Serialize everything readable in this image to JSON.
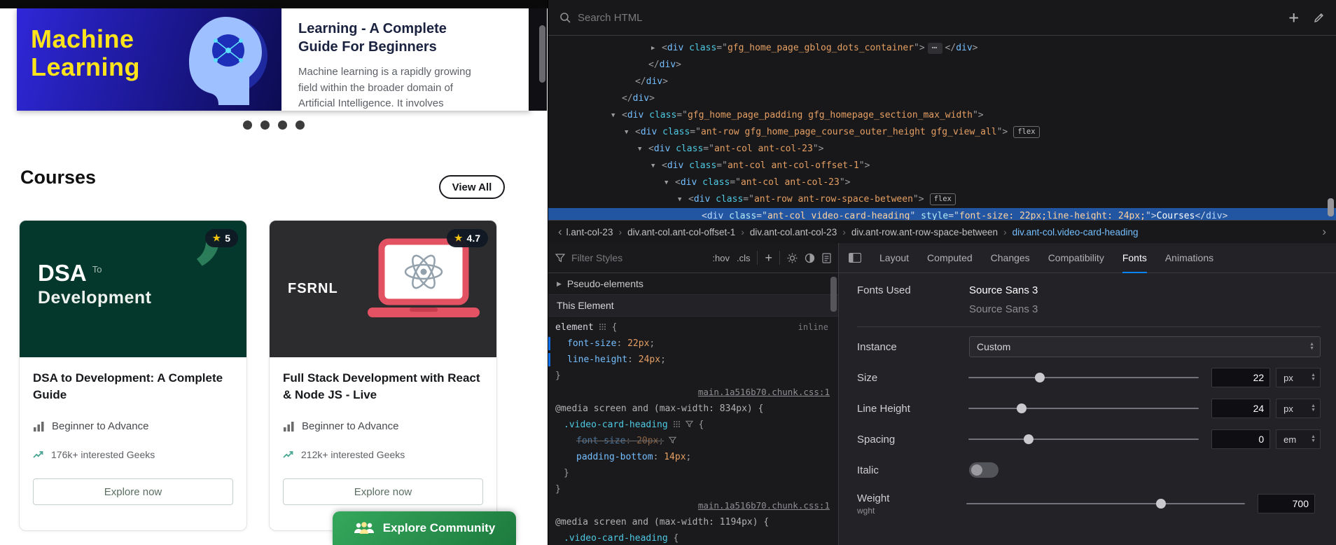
{
  "colors": {
    "accent": "#0a84ff",
    "selection_bg": "#2256a3",
    "devtools_bg": "#18181a",
    "border": "#3a3a3e",
    "tag": "#75bfff",
    "attribute": "#4ec9e1",
    "css_value": "#e59f63",
    "banner_yellow": "#ffe41c",
    "banner_blue": "#1c1894",
    "card1_green": "#05382c",
    "card2_gray": "#2c2c2f",
    "community_green": "#2f9e54",
    "star_yellow": "#f2c410"
  },
  "icons": {
    "star": "★",
    "ellipsis": "⋯",
    "collapse": "▼",
    "expand": "▶",
    "chevron_left": "‹",
    "chevron_right": "›",
    "plus": "+",
    "up": "▲",
    "down": "▼"
  },
  "page": {
    "carousel": {
      "banner_line1": "Machine",
      "banner_line2": "Learning",
      "title": "Learning - A Complete Guide For Beginners",
      "description": "Machine learning is a rapidly growing field within the broader domain of Artificial Intelligence. It involves developing algorithms that",
      "dot_count": 4
    },
    "courses": {
      "heading": "Courses",
      "view_all": "View All",
      "cards": [
        {
          "rating": "5",
          "img_line1": "DSA",
          "img_line1b": "To",
          "img_line2": "Development",
          "quote_glyph": "’",
          "title": "DSA to Development: A Complete Guide",
          "level": "Beginner to Advance",
          "interested": "176k+ interested Geeks",
          "cta": "Explore now"
        },
        {
          "rating": "4.7",
          "img_title": "FSRNL",
          "title": "Full Stack Development with React & Node JS - Live",
          "level": "Beginner to Advance",
          "interested": "212k+ interested Geeks",
          "cta": "Explore now"
        }
      ]
    },
    "community_button": "Explore Community"
  },
  "devtools": {
    "search_placeholder": "Search HTML",
    "markup_lines": [
      {
        "depth": 8,
        "tri": "expand",
        "tag": "div",
        "attrs": [
          [
            "class",
            "gfg_home_page_gblog_dots_container"
          ]
        ],
        "ellipsis": true
      },
      {
        "depth": 7,
        "close": "div"
      },
      {
        "depth": 6,
        "close": "div"
      },
      {
        "depth": 5,
        "close": "div"
      },
      {
        "depth": 5,
        "tri": "collapse",
        "tag": "div",
        "attrs": [
          [
            "class",
            "gfg_home_page_padding gfg_homepage_section_max_width"
          ]
        ]
      },
      {
        "depth": 6,
        "tri": "collapse",
        "tag": "div",
        "attrs": [
          [
            "class",
            "ant-row gfg_home_page_course_outer_height gfg_view_all"
          ]
        ],
        "badge": "flex"
      },
      {
        "depth": 7,
        "tri": "collapse",
        "tag": "div",
        "attrs": [
          [
            "class",
            "ant-col ant-col-23"
          ]
        ]
      },
      {
        "depth": 8,
        "tri": "collapse",
        "tag": "div",
        "attrs": [
          [
            "class",
            "ant-col ant-col-offset-1"
          ]
        ]
      },
      {
        "depth": 9,
        "tri": "collapse",
        "tag": "div",
        "attrs": [
          [
            "class",
            "ant-col ant-col-23"
          ]
        ]
      },
      {
        "depth": 10,
        "tri": "collapse",
        "tag": "div",
        "attrs": [
          [
            "class",
            "ant-row ant-row-space-between"
          ]
        ],
        "badge": "flex"
      },
      {
        "depth": 11,
        "selected": true,
        "tag": "div",
        "attrs": [
          [
            "class",
            "ant-col video-card-heading"
          ],
          [
            "style",
            "font-size: 22px;line-height: 24px;"
          ]
        ],
        "text": "Courses"
      }
    ],
    "breadcrumbs": {
      "items": [
        "l.ant-col-23",
        "div.ant-col.ant-col-offset-1",
        "div.ant-col.ant-col-23",
        "div.ant-row.ant-row-space-between",
        "div.ant-col.video-card-heading"
      ],
      "active_index": 4
    },
    "rules_panel": {
      "filter_placeholder": "Filter Styles",
      "hov": ":hov",
      "cls": ".cls",
      "plus": "+",
      "pseudo_header": "Pseudo-elements",
      "this_element_header": "This Element",
      "blocks": [
        {
          "kind": "rule",
          "selector": "element",
          "selector_type": "element",
          "location": "inline",
          "props": [
            {
              "name": "font-size",
              "value": "22px",
              "changed": true
            },
            {
              "name": "line-height",
              "value": "24px",
              "changed": true
            }
          ]
        },
        {
          "kind": "link",
          "text": "main.1a516b70.chunk.css:1"
        },
        {
          "kind": "media",
          "query": "@media screen and (max-width: 834px) {",
          "rules": [
            {
              "selector": ".video-card-heading",
              "props": [
                {
                  "name": "font-size",
                  "value": "20px",
                  "overridden": true
                },
                {
                  "name": "padding-bottom",
                  "value": "14px"
                }
              ]
            }
          ]
        },
        {
          "kind": "link",
          "text": "main.1a516b70.chunk.css:1"
        },
        {
          "kind": "media_partial",
          "query": "@media screen and (max-width: 1194px) {",
          "selector": ".video-card-heading"
        }
      ]
    },
    "fonts_panel": {
      "tabs": [
        "Layout",
        "Computed",
        "Changes",
        "Compatibility",
        "Fonts",
        "Animations"
      ],
      "active_tab": "Fonts",
      "fonts_used_label": "Fonts Used",
      "font_primary": "Source Sans 3",
      "font_secondary": "Source Sans 3",
      "controls": {
        "instance": {
          "label": "Instance",
          "value": "Custom"
        },
        "size": {
          "label": "Size",
          "value": "22",
          "unit": "px",
          "frac": 0.31
        },
        "line_height": {
          "label": "Line Height",
          "value": "24",
          "unit": "px",
          "frac": 0.23
        },
        "spacing": {
          "label": "Spacing",
          "value": "0",
          "unit": "em",
          "frac": 0.26
        },
        "italic": {
          "label": "Italic",
          "on": false
        },
        "weight": {
          "label": "Weight",
          "sub_label": "wght",
          "value": "700",
          "frac": 0.7
        }
      }
    }
  }
}
